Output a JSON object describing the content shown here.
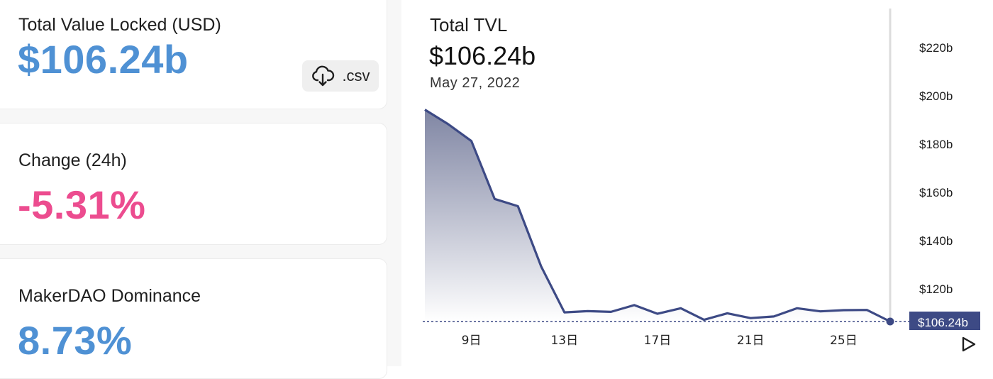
{
  "cards": {
    "tvl": {
      "label": "Total Value Locked (USD)",
      "value": "$106.24b"
    },
    "change": {
      "label": "Change (24h)",
      "value": "-5.31%"
    },
    "dominance": {
      "label": "MakerDAO Dominance",
      "value": "8.73%"
    }
  },
  "download": {
    "label": ".csv",
    "icon": "cloud-download-icon"
  },
  "chart": {
    "title": "Total TVL",
    "value": "$106.24b",
    "date": "May 27, 2022",
    "play_icon": "play-icon"
  },
  "colors": {
    "accent_blue": "#4f91d4",
    "negative_pink": "#ec4c8f",
    "series_line": "#3d4a85",
    "current_label_bg": "#3d4a85"
  },
  "chart_data": {
    "type": "area",
    "title": "Total TVL",
    "x": [
      7,
      8,
      9,
      10,
      11,
      12,
      13,
      14,
      15,
      16,
      17,
      18,
      19,
      20,
      21,
      22,
      23,
      24,
      25,
      26,
      27
    ],
    "x_unit": "day of month (May 2022)",
    "series": [
      {
        "values": [
          194,
          188,
          181,
          157,
          154,
          129,
          110,
          110.5,
          110.2,
          113,
          109.4,
          111.7,
          106.9,
          109.6,
          107.6,
          108.3,
          111.7,
          110.4,
          110.9,
          111,
          106.2
        ]
      }
    ],
    "x_ticks": [
      "9日",
      "13日",
      "17日",
      "21日",
      "25日"
    ],
    "x_tick_values": [
      9,
      13,
      17,
      21,
      25
    ],
    "y_ticks": [
      "$120b",
      "$140b",
      "$160b",
      "$180b",
      "$200b",
      "$220b"
    ],
    "y_tick_values": [
      120,
      140,
      160,
      180,
      200,
      220
    ],
    "ylim": [
      106.2,
      224
    ],
    "current_value_label": "$106.24b",
    "grid": false
  }
}
